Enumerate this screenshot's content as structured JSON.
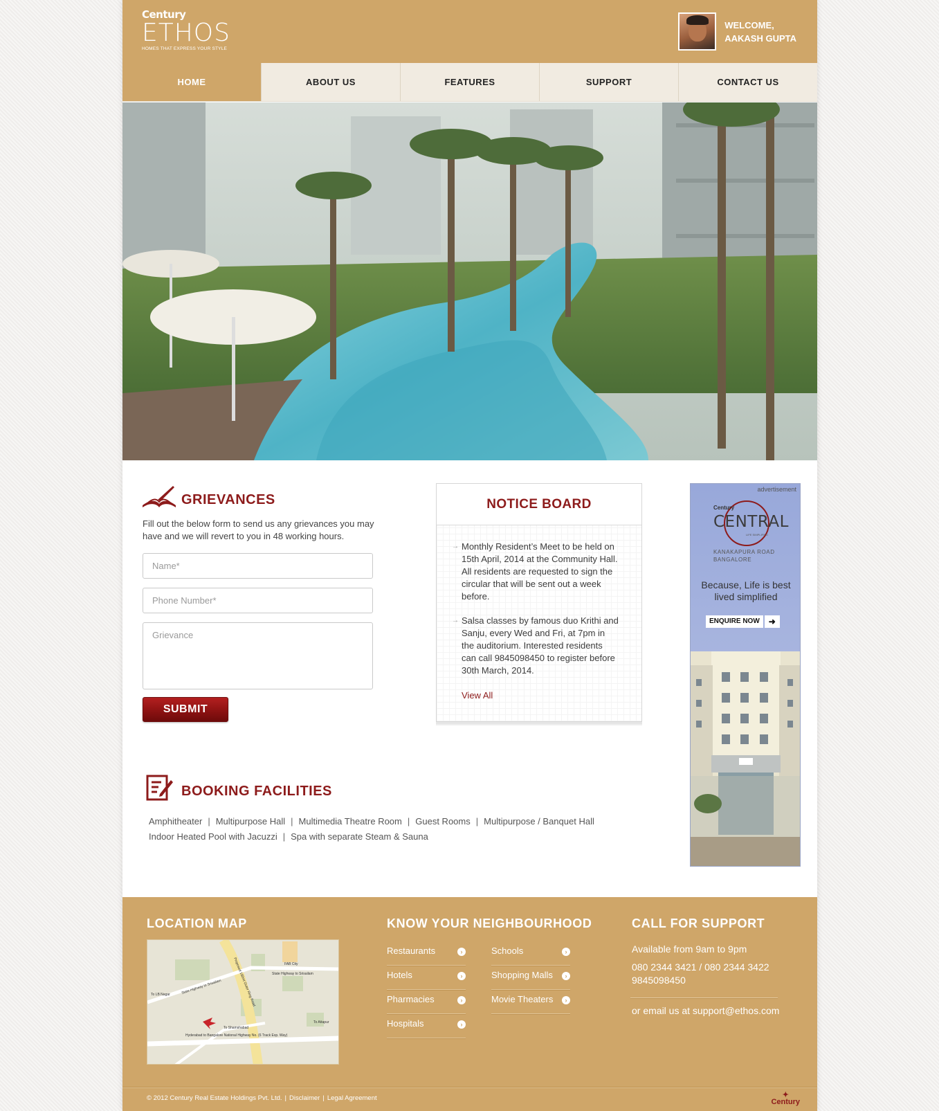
{
  "header": {
    "logo_top": "Century",
    "logo_main": "ETHOS",
    "logo_tagline": "HOMES THAT EXPRESS YOUR STYLE",
    "welcome_line1": "WELCOME,",
    "welcome_line2": "AAKASH GUPTA"
  },
  "nav": {
    "items": [
      "HOME",
      "ABOUT US",
      "FEATURES",
      "SUPPORT",
      "CONTACT US"
    ],
    "active": "HOME"
  },
  "grievances": {
    "title": "GRIEVANCES",
    "description": "Fill out the below form to send us any grievances you may have and we will revert to you in 48 working hours.",
    "name_placeholder": "Name*",
    "phone_placeholder": "Phone Number*",
    "grievance_placeholder": "Grievance",
    "submit_label": "SUBMIT"
  },
  "notice_board": {
    "title": "NOTICE BOARD",
    "items": [
      "Monthly Resident’s Meet to be held on 15th April, 2014 at the Community Hall. All residents are requested to sign the circular that will be sent out a week before.",
      "Salsa classes by famous duo Krithi and Sanju, every Wed and Fri, at 7pm in the auditorium. Interested residents can call 9845098450 to register before 30th March, 2014."
    ],
    "view_all": "View All"
  },
  "advertisement": {
    "label": "advertisement",
    "brand": "Century",
    "name": "CENTRAL",
    "sub": "LIFE SIMPLIFIED",
    "location_line1": "KANAKAPURA ROAD",
    "location_line2": "BANGALORE",
    "tagline": "Because, Life is best lived simplified",
    "cta": "ENQUIRE NOW"
  },
  "booking": {
    "title": "BOOKING FACILITIES",
    "row1": [
      "Amphitheater",
      "Multipurpose Hall",
      "Multimedia Theatre Room",
      "Guest Rooms",
      "Multipurpose / Banquet Hall"
    ],
    "row2": [
      "Indoor Heated Pool with Jacuzzi",
      "Spa with separate Steam & Sauna"
    ]
  },
  "footer": {
    "location_title": "LOCATION MAP",
    "neighbourhood_title": "KNOW YOUR NEIGHBOURHOOD",
    "neighbourhood_col1": [
      "Restaurants",
      "Hotels",
      "Pharmacies",
      "Hospitals"
    ],
    "neighbourhood_col2": [
      "Schools",
      "Shopping Malls",
      "Movie Theaters"
    ],
    "support_title": "CALL FOR SUPPORT",
    "support_hours": "Available from 9am to 9pm",
    "support_phones": "080 2344 3421 / 080 2344 3422",
    "support_mobile": "9845098450",
    "support_email": "or email us at support@ethos.com",
    "copyright": "© 2012 Century Real Estate Holdings Pvt. Ltd.",
    "disclaimer": "Disclaimer",
    "legal": "Legal Agreement",
    "logo_text": "Century"
  },
  "map": {
    "labels": [
      "State Highway to Srisailam",
      "State Highway to Srisailam",
      "Proposed 150mt Outer Ring Road",
      "FAB City",
      "To Shamshabad",
      "Hyderabad to Bangalore National Highway No. (6 Track Exp. Way)",
      "To LB Nagar",
      "To Attapur"
    ]
  },
  "colors": {
    "brand_gold": "#cfa669",
    "accent_red": "#8d1b1b",
    "nav_bg": "#f1ebe1"
  }
}
